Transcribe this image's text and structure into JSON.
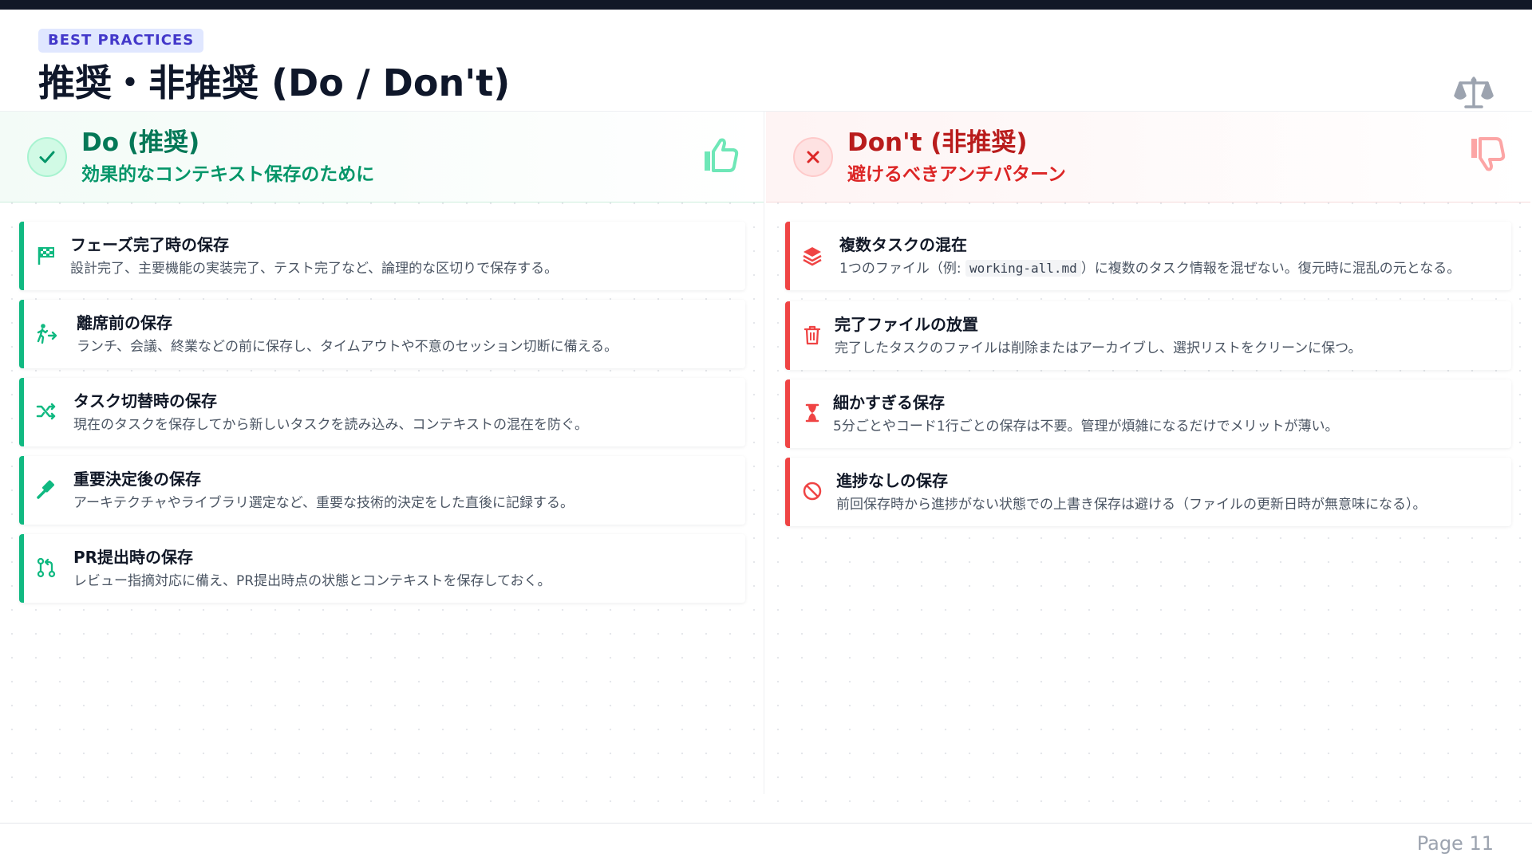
{
  "header": {
    "tag": "BEST PRACTICES",
    "title": "推奨・非推奨 (Do / Don't)"
  },
  "do": {
    "title": "Do (推奨)",
    "subtitle": "効果的なコンテキスト保存のために",
    "items": [
      {
        "title": "フェーズ完了時の保存",
        "desc": "設計完了、主要機能の実装完了、テスト完了など、論理的な区切りで保存する。",
        "icon": "flag-checkered-icon"
      },
      {
        "title": "離席前の保存",
        "desc": "ランチ、会議、終業などの前に保存し、タイムアウトや不意のセッション切断に備える。",
        "icon": "person-walking-arrow-icon"
      },
      {
        "title": "タスク切替時の保存",
        "desc": "現在のタスクを保存してから新しいタスクを読み込み、コンテキストの混在を防ぐ。",
        "icon": "shuffle-icon"
      },
      {
        "title": "重要決定後の保存",
        "desc": "アーキテクチャやライブラリ選定など、重要な技術的決定をした直後に記録する。",
        "icon": "gavel-icon"
      },
      {
        "title": "PR提出時の保存",
        "desc": "レビュー指摘対応に備え、PR提出時点の状態とコンテキストを保存しておく。",
        "icon": "code-pull-request-icon"
      }
    ]
  },
  "dont": {
    "title": "Don't (非推奨)",
    "subtitle": "避けるべきアンチパターン",
    "items": [
      {
        "title": "複数タスクの混在",
        "desc_before": "1つのファイル（例: ",
        "desc_code": "working-all.md",
        "desc_after": "）に複数のタスク情報を混ぜない。復元時に混乱の元となる。",
        "icon": "layer-group-icon"
      },
      {
        "title": "完了ファイルの放置",
        "desc": "完了したタスクのファイルは削除またはアーカイブし、選択リストをクリーンに保つ。",
        "icon": "trash-can-icon"
      },
      {
        "title": "細かすぎる保存",
        "desc": "5分ごとやコード1行ごとの保存は不要。管理が煩雑になるだけでメリットが薄い。",
        "icon": "hourglass-icon"
      },
      {
        "title": "進捗なしの保存",
        "desc": "前回保存時から進捗がない状態での上書き保存は避ける（ファイルの更新日時が無意味になる）。",
        "icon": "ban-icon"
      }
    ]
  },
  "footer": {
    "page": "Page 11"
  },
  "colors": {
    "do": "#10b981",
    "dont": "#ef4444",
    "tag_bg": "#e0e7ff",
    "tag_text": "#4338ca"
  }
}
